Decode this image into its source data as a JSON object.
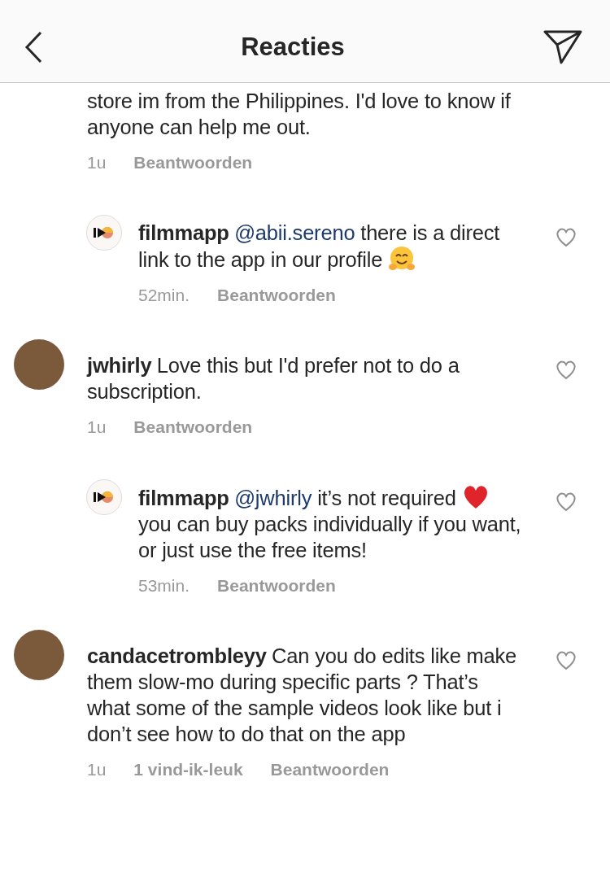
{
  "header": {
    "title": "Reacties"
  },
  "comments": [
    {
      "kind": "continued",
      "segments": [
        {
          "kind": "text",
          "text": "store im from the Philippines. I'd love to know if anyone can help me out."
        }
      ],
      "time": "1u",
      "reply": "Beantwoorden",
      "heart": false
    },
    {
      "kind": "reply",
      "username": "filmmapp",
      "segments": [
        {
          "kind": "mention",
          "text": "@abii.sereno"
        },
        {
          "kind": "text",
          "text": " there is a direct link to the app in our profile "
        },
        {
          "kind": "hug"
        }
      ],
      "time": "52min.",
      "reply": "Beantwoorden",
      "heart": true
    },
    {
      "kind": "comment",
      "username": "jwhirly",
      "segments": [
        {
          "kind": "text",
          "text": "Love this but I'd prefer not to do a subscription."
        }
      ],
      "time": "1u",
      "reply": "Beantwoorden",
      "heart": true
    },
    {
      "kind": "reply",
      "username": "filmmapp",
      "segments": [
        {
          "kind": "mention",
          "text": "@jwhirly"
        },
        {
          "kind": "text",
          "text": " it’s not required "
        },
        {
          "kind": "heart"
        },
        {
          "kind": "text",
          "text": " you can buy packs individually if you want, or just use the free items!"
        }
      ],
      "time": "53min.",
      "reply": "Beantwoorden",
      "heart": true
    },
    {
      "kind": "comment",
      "username": "candacetrombleyy",
      "segments": [
        {
          "kind": "text",
          "text": "Can you do edits like make them slow-mo during specific parts ? That’s what some of the sample videos look like but i don’t see how to do that on the app"
        }
      ],
      "time": "1u",
      "likes": "1 vind-ik-leuk",
      "reply": "Beantwoorden",
      "heart": true
    }
  ]
}
